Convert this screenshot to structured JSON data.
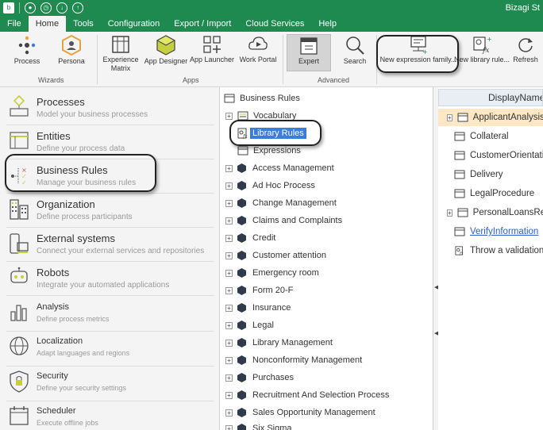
{
  "titlebar": {
    "title": "Bizagi St"
  },
  "menu": {
    "items": [
      "File",
      "Home",
      "Tools",
      "Configuration",
      "Export / Import",
      "Cloud Services",
      "Help"
    ]
  },
  "ribbon": {
    "wizards": {
      "label": "Wizards",
      "process": "Process",
      "persona": "Persona"
    },
    "apps": {
      "label": "Apps",
      "experience_line1": "Experience",
      "experience_line2": "Matrix",
      "app_designer": "App Designer",
      "app_launcher": "App Launcher",
      "work_portal": "Work Portal"
    },
    "advanced": {
      "label": "Advanced",
      "expert": "Expert",
      "search": "Search"
    },
    "new_expression_family": "New expression family...",
    "new_library_rule": "New library rule...",
    "refresh": "Refresh"
  },
  "leftnav": {
    "items": [
      {
        "title": "Processes",
        "subtitle": "Model your business processes"
      },
      {
        "title": "Entities",
        "subtitle": "Define your process data"
      },
      {
        "title": "Business Rules",
        "subtitle": "Manage your business rules"
      },
      {
        "title": "Organization",
        "subtitle": "Define process participants"
      },
      {
        "title": "External systems",
        "subtitle": "Connect your external services and repositories"
      },
      {
        "title": "Robots",
        "subtitle": "Integrate your automated applications"
      },
      {
        "title": "Analysis",
        "subtitle": "Define process metrics"
      },
      {
        "title": "Localization",
        "subtitle": "Adapt languages and regions"
      },
      {
        "title": "Security",
        "subtitle": "Define your security settings"
      },
      {
        "title": "Scheduler",
        "subtitle": "Execute offline jobs"
      }
    ]
  },
  "tree": {
    "root": "Business Rules",
    "vocabulary": "Vocabulary",
    "library_rules": "Library Rules",
    "expressions": "Expressions",
    "processes": [
      "Access Management",
      "Ad Hoc Process",
      "Change Management",
      "Claims and Complaints",
      "Credit",
      "Customer attention",
      "Emergency room",
      "Form 20-F",
      "Insurance",
      "Legal",
      "Library Management",
      "Nonconformity Management",
      "Purchases",
      "Recruitment And Selection Process",
      "Sales Opportunity Management",
      "Six Sigma"
    ]
  },
  "rightpane": {
    "header": "DisplayName",
    "rows": [
      "ApplicantAnalysis",
      "Collateral",
      "CustomerOrientation",
      "Delivery",
      "LegalProcedure",
      "PersonalLoansRequest",
      "VerifyInformation",
      "Throw a validation"
    ]
  },
  "colors": {
    "brand_green": "#1e8a50",
    "selection_blue": "#3b7dd8",
    "highlight_orange": "#fde7c4",
    "link_blue": "#2a5fc9"
  }
}
